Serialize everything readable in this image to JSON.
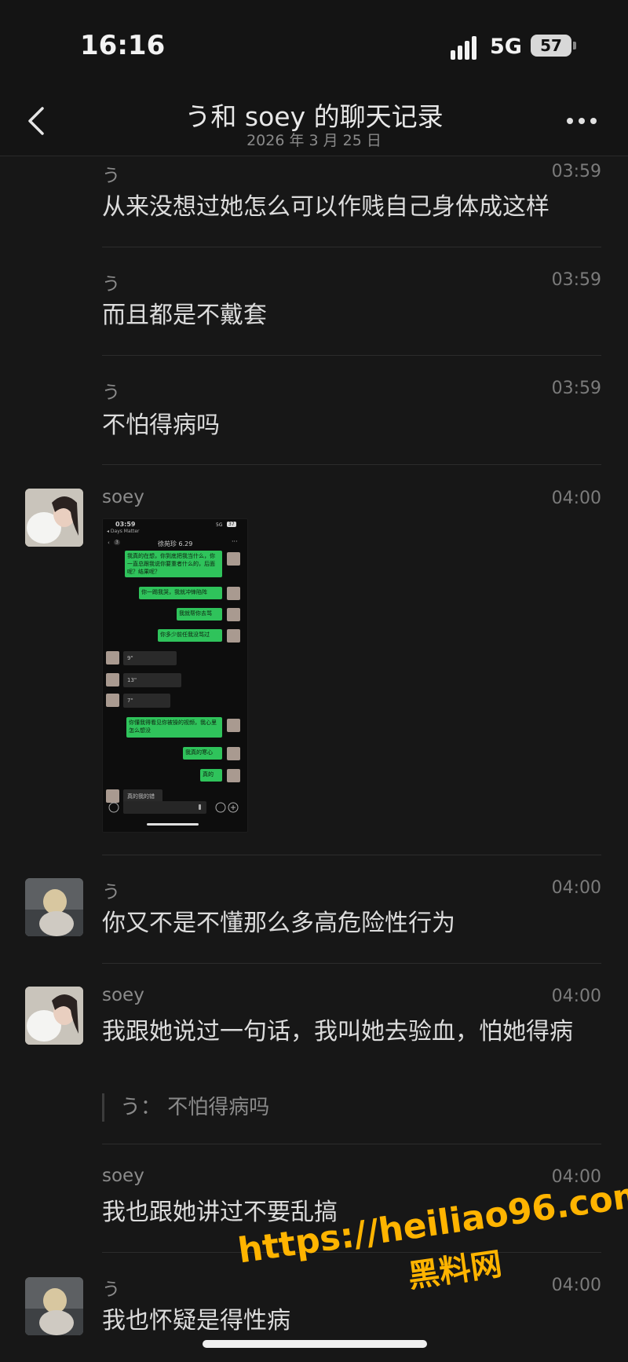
{
  "status": {
    "time": "16:16",
    "network": "5G",
    "battery": "57"
  },
  "header": {
    "title": "う和 soey 的聊天记录",
    "subtitle": "2026 年 3 月 25 日"
  },
  "messages": [
    {
      "sender": "う",
      "time": "03:59",
      "text": "从来没想过她怎么可以作贱自己身体成这样"
    },
    {
      "sender": "う",
      "time": "03:59",
      "text": "而且都是不戴套"
    },
    {
      "sender": "う",
      "time": "03:59",
      "text": "不怕得病吗"
    },
    {
      "sender": "soey",
      "time": "04:00",
      "image": {
        "status_time": "03:59",
        "status_sub": "◂ Days Matter",
        "status_net": "5G",
        "status_batt": "37",
        "chat_title": "徐苑珍 6.29",
        "back_badge": "3",
        "bubbles": [
          "我真的在想，你到底把我当什么，你一直总跟我说你要重者什么的，后面呢？结果呢？",
          "你一踢我哭，我就冲锋陷阵",
          "我就帮你去骂",
          "你多少前任我没骂过",
          "你懂我得看见你被操的视频，我心里怎么想没",
          "我真的寒心",
          "真的"
        ],
        "voices": [
          "9\"",
          "13\"",
          "7\""
        ],
        "received_text": "真的我的错"
      }
    },
    {
      "sender": "う",
      "time": "04:00",
      "text": "你又不是不懂那么多高危险性行为"
    },
    {
      "sender": "soey",
      "time": "04:00",
      "text": "我跟她说过一句话，我叫她去验血，怕她得病",
      "quote": "う：  不怕得病吗"
    },
    {
      "sender": "soey",
      "time": "04:00",
      "text": "我也跟她讲过不要乱搞"
    },
    {
      "sender": "う",
      "time": "04:00",
      "text": "我也怀疑是得性病"
    }
  ],
  "watermark": {
    "url": "https://heiliao96.com",
    "name": "黑料网"
  },
  "colors": {
    "background": "#171717",
    "bubble_green": "#2fc35b",
    "watermark": "#ffb400"
  }
}
